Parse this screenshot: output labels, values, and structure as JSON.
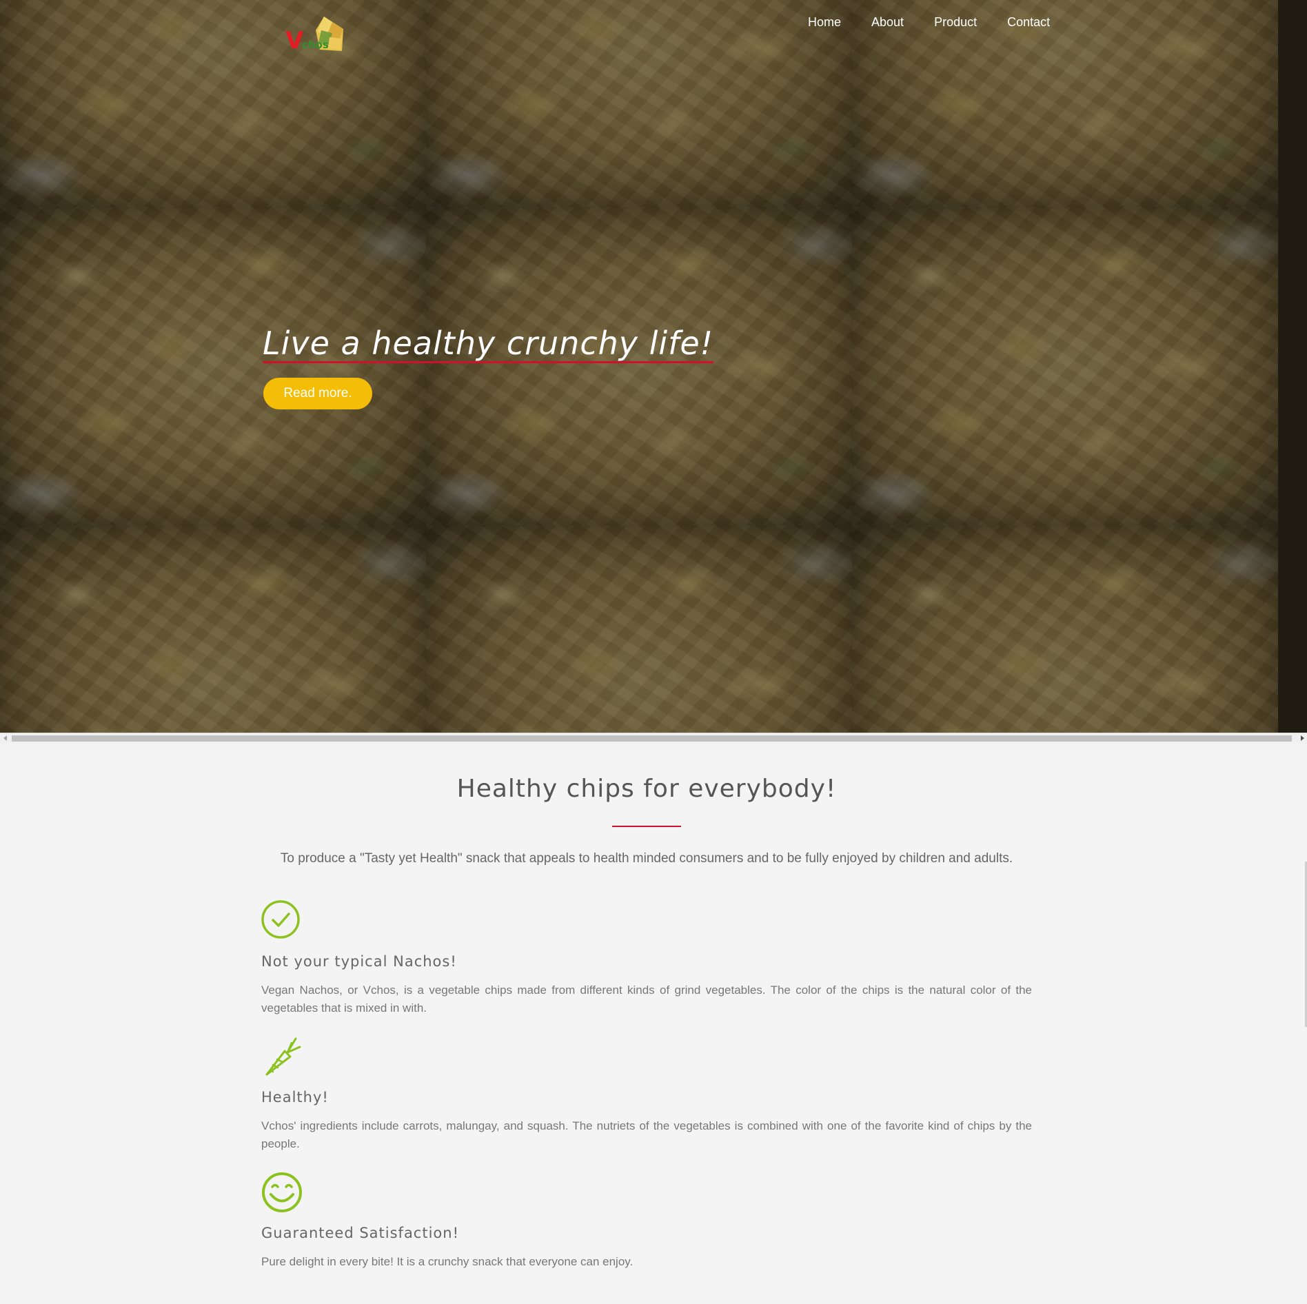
{
  "brand": {
    "logo_letter": "V",
    "logo_rest": "chos"
  },
  "nav": {
    "items": [
      {
        "label": "Home"
      },
      {
        "label": "About"
      },
      {
        "label": "Product"
      },
      {
        "label": "Contact"
      }
    ]
  },
  "hero": {
    "headline": "Live a healthy crunchy life!",
    "cta_label": "Read more."
  },
  "section": {
    "title": "Healthy chips for everybody!",
    "intro": "To produce a \"Tasty yet Health\" snack that appeals to health minded consumers and to be fully enjoyed by children and adults."
  },
  "features": [
    {
      "icon": "check-circle-icon",
      "title": "Not your typical Nachos!",
      "body": "Vegan Nachos, or Vchos, is a vegetable chips made from different kinds of grind vegetables. The color of the chips is the natural color of the vegetables that is mixed in with."
    },
    {
      "icon": "carrot-icon",
      "title": "Healthy!",
      "body": "Vchos' ingredients include carrots, malungay, and squash. The nutriets of the vegetables is combined with one of the favorite kind of chips by the people."
    },
    {
      "icon": "smiley-icon",
      "title": "Guaranteed Satisfaction!",
      "body": "Pure delight in every bite! It is a crunchy snack that everyone can enjoy."
    }
  ],
  "colors": {
    "accent_red": "#d0112b",
    "cta_yellow": "#f4bd08",
    "icon_green": "#8cc21f",
    "page_bg": "#f4f4f4",
    "text_gray": "#666666"
  }
}
